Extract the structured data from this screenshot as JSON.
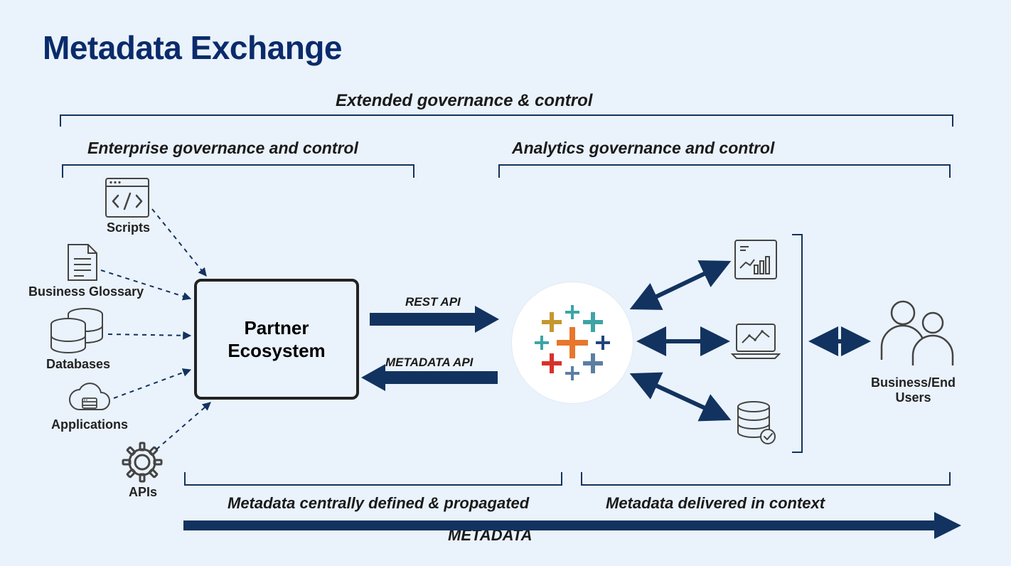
{
  "title": "Metadata Exchange",
  "labels": {
    "extended_governance": "Extended governance & control",
    "enterprise_governance": "Enterprise governance and control",
    "analytics_governance": "Analytics governance and control",
    "rest_api": "REST API",
    "metadata_api": "METADATA API",
    "metadata_centrally": "Metadata centrally defined & propagated",
    "metadata_context": "Metadata delivered in context",
    "metadata_flow": "METADATA"
  },
  "nodes": {
    "partner_ecosystem": "Partner\nEcosystem",
    "scripts": "Scripts",
    "business_glossary": "Business Glossary",
    "databases": "Databases",
    "applications": "Applications",
    "apis": "APIs",
    "business_end_users": "Business/End\nUsers"
  },
  "colors": {
    "arrow": "#12335f",
    "title": "#0a2b6b",
    "icon_stroke": "#444"
  }
}
